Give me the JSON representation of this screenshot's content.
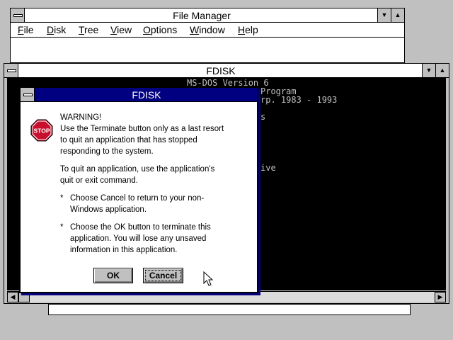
{
  "file_manager": {
    "title": "File Manager",
    "menu": [
      "File",
      "Disk",
      "Tree",
      "View",
      "Options",
      "Window",
      "Help"
    ]
  },
  "dos_window": {
    "title": "FDISK",
    "lines": [
      "MS-DOS Version 6",
      "Program",
      "rp. 1983 - 1993",
      "s",
      "ive"
    ]
  },
  "dialog": {
    "title": "FDISK",
    "icon": "stop-icon",
    "icon_text": "STOP",
    "heading": "WARNING!",
    "para1": "Use the Terminate button only as a last resort\nto quit an application that has stopped\nresponding to the system.",
    "para2": "To quit an application, use the application's\nquit or exit command.",
    "bullet_mark": "*",
    "bullet1": "Choose Cancel to return to your non-\nWindows application.",
    "bullet2": "Choose the OK button to terminate this\napplication. You will lose any unsaved\ninformation in this application.",
    "ok_label": "OK",
    "cancel_label": "Cancel"
  },
  "colors": {
    "desktop": "#c0c0c0",
    "dialog_title": "#000080",
    "dos_background": "#000000",
    "stop_red": "#c8102e"
  }
}
